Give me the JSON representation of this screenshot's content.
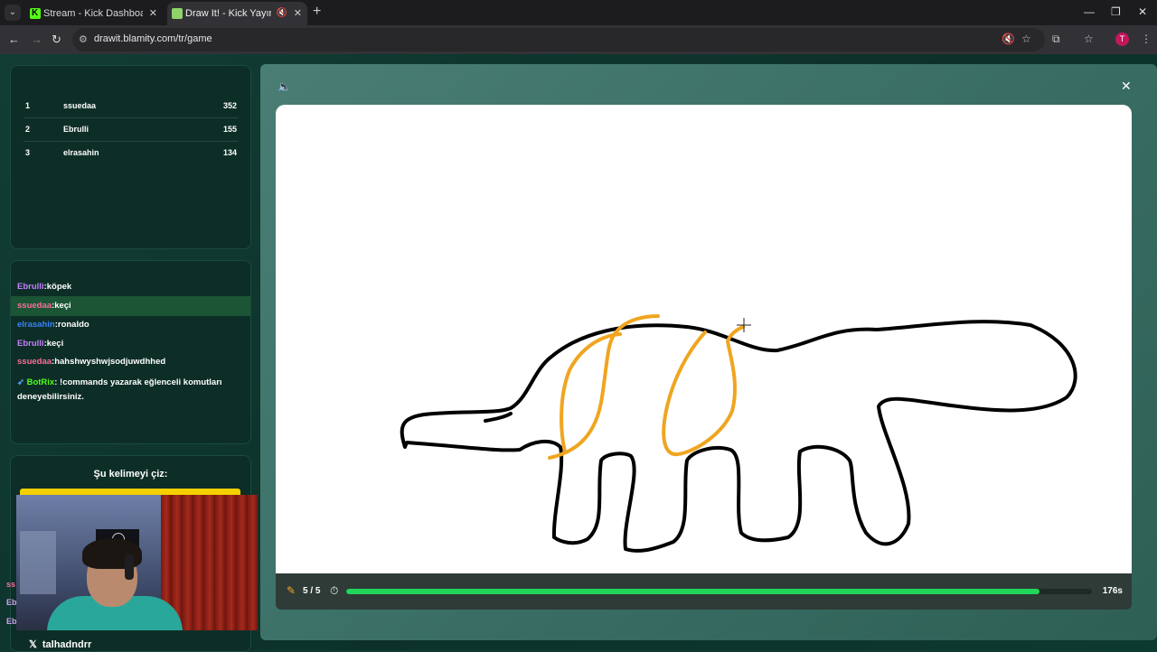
{
  "browser": {
    "tabs": [
      {
        "title": "Stream - Kick Dashboard",
        "active": false
      },
      {
        "title": "Draw It! - Kick Yayınları İçin",
        "active": true
      }
    ],
    "url": "drawit.blamity.com/tr/game",
    "profile_initial": "T"
  },
  "leaderboard": [
    {
      "rank": "1",
      "name": "ssuedaa",
      "score": "352"
    },
    {
      "rank": "2",
      "name": "Ebrulli",
      "score": "155"
    },
    {
      "rank": "3",
      "name": "elrasahin",
      "score": "134"
    }
  ],
  "chat": [
    {
      "user": "Ebrulli",
      "text": ":köpek",
      "color": "#c77dff",
      "highlight": false
    },
    {
      "user": "ssuedaa",
      "text": ":keçi",
      "color": "#ff6b9a",
      "highlight": true
    },
    {
      "user": "elrasahin",
      "text": ":ronaldo",
      "color": "#3b82f6",
      "highlight": false
    },
    {
      "user": "Ebrulli",
      "text": ":keçi",
      "color": "#c77dff",
      "highlight": false
    },
    {
      "user": "ssuedaa",
      "text": ":hahshwyshwjsodjuwdhhed",
      "color": "#ff6b9a",
      "highlight": false
    },
    {
      "user": "BotRix",
      "text": ": !commands yazarak eğlenceli komutları deneyebilirsiniz.",
      "color": "#53fc18",
      "highlight": false,
      "bot": true
    }
  ],
  "word_panel": {
    "label": "Şu kelimeyi çiz:"
  },
  "overlay": {
    "handle": "talhadndrr",
    "partial_names": [
      "ss",
      "Eb",
      "Eb"
    ]
  },
  "game": {
    "round_label": "5 / 5",
    "time_left": "176s",
    "progress": 0.93,
    "colors": {
      "outline": "#000000",
      "stripes": "#f0a520",
      "progress": "#22d65a"
    }
  },
  "icons": [
    "speaker-icon",
    "close-icon",
    "pencil-icon",
    "timer-icon",
    "kick-favicon",
    "star-icon",
    "extensions-icon"
  ]
}
